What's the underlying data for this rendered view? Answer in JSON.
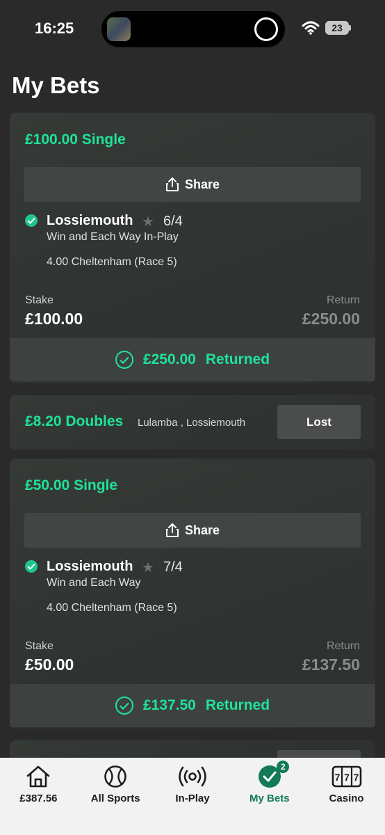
{
  "status_bar": {
    "time": "16:25",
    "battery": "23"
  },
  "page_title": "My Bets",
  "bets": [
    {
      "title": "£100.00 Single",
      "share_label": "Share",
      "selection": "Lossiemouth",
      "odds": "6/4",
      "market": "Win and Each Way In-Play",
      "race": "4.00 Cheltenham (Race 5)",
      "stake_label": "Stake",
      "stake": "£100.00",
      "return_label": "Return",
      "return": "£250.00",
      "returned_amount": "£250.00",
      "returned_label": "Returned"
    },
    {
      "title": "£8.20 Doubles",
      "selections": "Lulamba , Lossiemouth",
      "status": "Lost"
    },
    {
      "title": "£50.00 Single",
      "share_label": "Share",
      "selection": "Lossiemouth",
      "odds": "7/4",
      "market": "Win and Each Way",
      "race": "4.00 Cheltenham (Race 5)",
      "stake_label": "Stake",
      "stake": "£50.00",
      "return_label": "Return",
      "return": "£137.50",
      "returned_amount": "£137.50",
      "returned_label": "Returned"
    }
  ],
  "tab_bar": {
    "tabs": [
      {
        "label": "£387.56",
        "icon": "home-icon"
      },
      {
        "label": "All Sports",
        "icon": "ball-icon"
      },
      {
        "label": "In-Play",
        "icon": "broadcast-icon"
      },
      {
        "label": "My Bets",
        "icon": "check-circle-icon",
        "badge": "2",
        "active": true
      },
      {
        "label": "Casino",
        "icon": "slot-machine-icon"
      }
    ]
  },
  "colors": {
    "accent": "#1ee39a",
    "active_tab": "#127a54",
    "background": "#2a2a2a"
  }
}
